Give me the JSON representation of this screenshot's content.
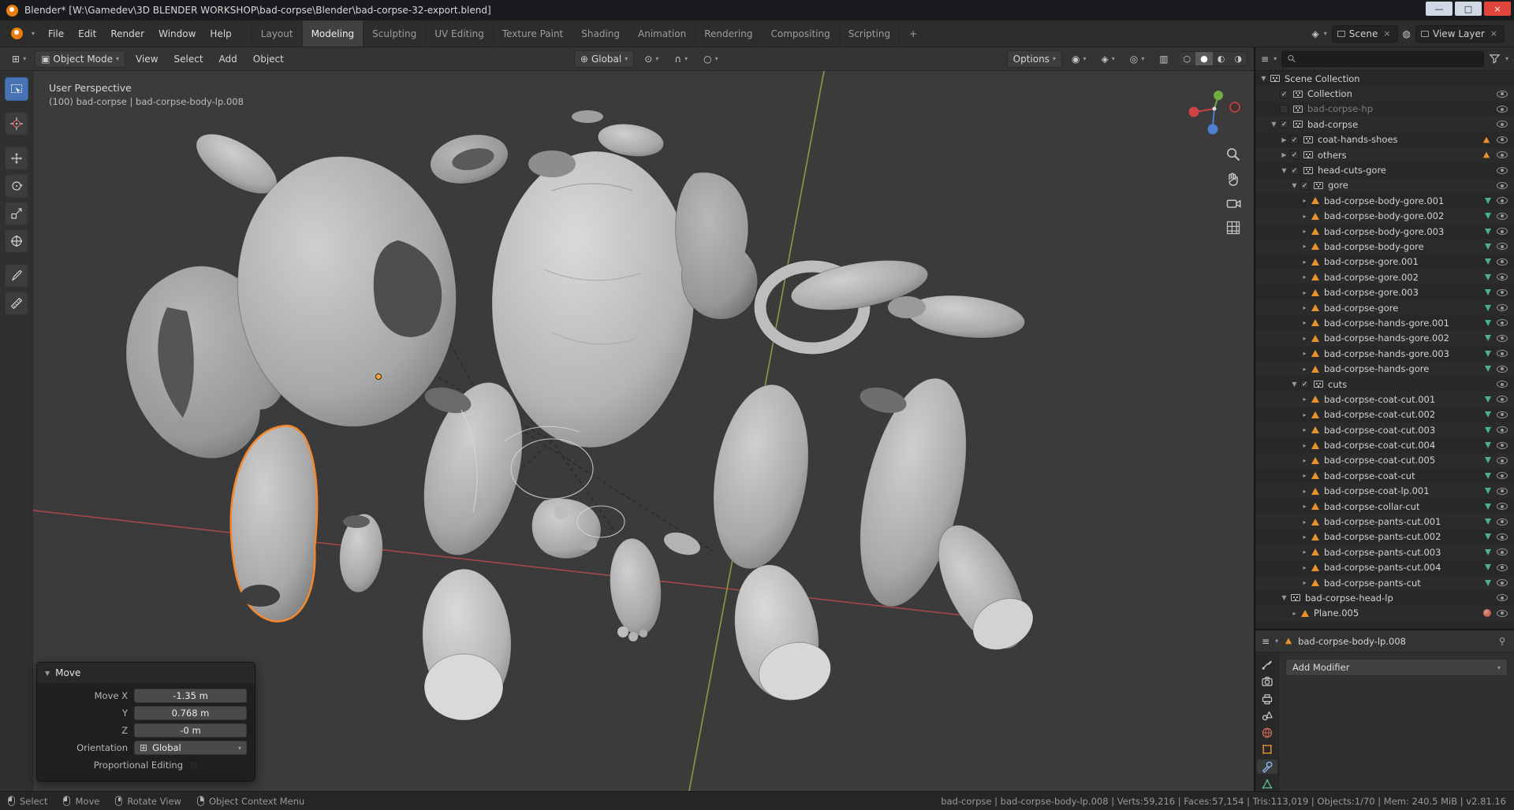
{
  "window": {
    "title": "Blender* [W:\\Gamedev\\3D BLENDER WORKSHOP\\bad-corpse\\Blender\\bad-corpse-32-export.blend]",
    "minimize": "—",
    "maximize": "□",
    "close": "×"
  },
  "menubar": {
    "menus": [
      "File",
      "Edit",
      "Render",
      "Window",
      "Help"
    ],
    "workspaces": [
      "Layout",
      "Modeling",
      "Sculpting",
      "UV Editing",
      "Texture Paint",
      "Shading",
      "Animation",
      "Rendering",
      "Compositing",
      "Scripting"
    ],
    "active_workspace": "Modeling",
    "add_workspace": "+",
    "scene": "Scene",
    "view_layer": "View Layer"
  },
  "viewport_header": {
    "mode": "Object Mode",
    "menus": [
      "View",
      "Select",
      "Add",
      "Object"
    ],
    "orientation": "Global",
    "options": "Options"
  },
  "toolbar_tools": [
    "select-box",
    "cursor",
    "move",
    "rotate",
    "scale",
    "transform",
    "annotate",
    "measure"
  ],
  "viewport": {
    "perspective": "User Perspective",
    "active_object_info": "(100) bad-corpse | bad-corpse-body-lp.008"
  },
  "move_panel": {
    "title": "Move",
    "fields": [
      {
        "label": "Move X",
        "value": "-1.35 m"
      },
      {
        "label": "Y",
        "value": "0.768 m"
      },
      {
        "label": "Z",
        "value": "-0 m"
      }
    ],
    "orientation_label": "Orientation",
    "orientation_value": "Global",
    "proportional": "Proportional Editing"
  },
  "outliner": {
    "rows": [
      {
        "label": "Scene Collection",
        "depth": 0,
        "type": "scene",
        "arrow": "down"
      },
      {
        "label": "Collection",
        "depth": 1,
        "type": "collection",
        "checked": true
      },
      {
        "label": "bad-corpse-hp",
        "depth": 1,
        "type": "collection",
        "checked": false,
        "dim": true
      },
      {
        "label": "bad-corpse",
        "depth": 1,
        "type": "collection",
        "checked": true,
        "arrow": "down"
      },
      {
        "label": "coat-hands-shoes",
        "depth": 2,
        "type": "collection",
        "checked": true,
        "arrow": "right",
        "badge": true
      },
      {
        "label": "others",
        "depth": 2,
        "type": "collection",
        "checked": true,
        "arrow": "right",
        "badge": true
      },
      {
        "label": "head-cuts-gore",
        "depth": 2,
        "type": "collection",
        "checked": true,
        "arrow": "down"
      },
      {
        "label": "gore",
        "depth": 3,
        "type": "collection",
        "checked": true,
        "arrow": "down"
      },
      {
        "label": "bad-corpse-body-gore.001",
        "depth": 4,
        "type": "mesh"
      },
      {
        "label": "bad-corpse-body-gore.002",
        "depth": 4,
        "type": "mesh"
      },
      {
        "label": "bad-corpse-body-gore.003",
        "depth": 4,
        "type": "mesh"
      },
      {
        "label": "bad-corpse-body-gore",
        "depth": 4,
        "type": "mesh"
      },
      {
        "label": "bad-corpse-gore.001",
        "depth": 4,
        "type": "mesh"
      },
      {
        "label": "bad-corpse-gore.002",
        "depth": 4,
        "type": "mesh"
      },
      {
        "label": "bad-corpse-gore.003",
        "depth": 4,
        "type": "mesh"
      },
      {
        "label": "bad-corpse-gore",
        "depth": 4,
        "type": "mesh"
      },
      {
        "label": "bad-corpse-hands-gore.001",
        "depth": 4,
        "type": "mesh"
      },
      {
        "label": "bad-corpse-hands-gore.002",
        "depth": 4,
        "type": "mesh"
      },
      {
        "label": "bad-corpse-hands-gore.003",
        "depth": 4,
        "type": "mesh"
      },
      {
        "label": "bad-corpse-hands-gore",
        "depth": 4,
        "type": "mesh"
      },
      {
        "label": "cuts",
        "depth": 3,
        "type": "collection",
        "checked": true,
        "arrow": "down"
      },
      {
        "label": "bad-corpse-coat-cut.001",
        "depth": 4,
        "type": "mesh"
      },
      {
        "label": "bad-corpse-coat-cut.002",
        "depth": 4,
        "type": "mesh"
      },
      {
        "label": "bad-corpse-coat-cut.003",
        "depth": 4,
        "type": "mesh"
      },
      {
        "label": "bad-corpse-coat-cut.004",
        "depth": 4,
        "type": "mesh"
      },
      {
        "label": "bad-corpse-coat-cut.005",
        "depth": 4,
        "type": "mesh"
      },
      {
        "label": "bad-corpse-coat-cut",
        "depth": 4,
        "type": "mesh"
      },
      {
        "label": "bad-corpse-coat-lp.001",
        "depth": 4,
        "type": "mesh"
      },
      {
        "label": "bad-corpse-collar-cut",
        "depth": 4,
        "type": "mesh"
      },
      {
        "label": "bad-corpse-pants-cut.001",
        "depth": 4,
        "type": "mesh"
      },
      {
        "label": "bad-corpse-pants-cut.002",
        "depth": 4,
        "type": "mesh"
      },
      {
        "label": "bad-corpse-pants-cut.003",
        "depth": 4,
        "type": "mesh"
      },
      {
        "label": "bad-corpse-pants-cut.004",
        "depth": 4,
        "type": "mesh"
      },
      {
        "label": "bad-corpse-pants-cut",
        "depth": 4,
        "type": "mesh"
      },
      {
        "label": "bad-corpse-head-lp",
        "depth": 2,
        "type": "object",
        "arrow": "down"
      },
      {
        "label": "Plane.005",
        "depth": 3,
        "type": "mesh-material"
      }
    ]
  },
  "properties": {
    "breadcrumb": "bad-corpse-body-lp.008",
    "add_modifier": "Add Modifier",
    "tabs": [
      "tool",
      "render",
      "output",
      "scene",
      "world",
      "object",
      "modifiers",
      "data"
    ],
    "active_tab": "modifiers"
  },
  "statusbar": {
    "hints": [
      "Select",
      "Move",
      "Rotate View",
      "Object Context Menu"
    ],
    "stats": [
      "bad-corpse | bad-corpse-body-lp.008",
      "Verts:59,216",
      "Faces:57,154",
      "Tris:113,019",
      "Objects:1/70",
      "Mem: 240.5 MiB",
      "v2.81.16"
    ]
  },
  "colors": {
    "accent_orange": "#e8912d",
    "selection_outline": "#f5882d",
    "active_blue": "#4772b3",
    "mesh_data_green": "#4ab08e"
  }
}
